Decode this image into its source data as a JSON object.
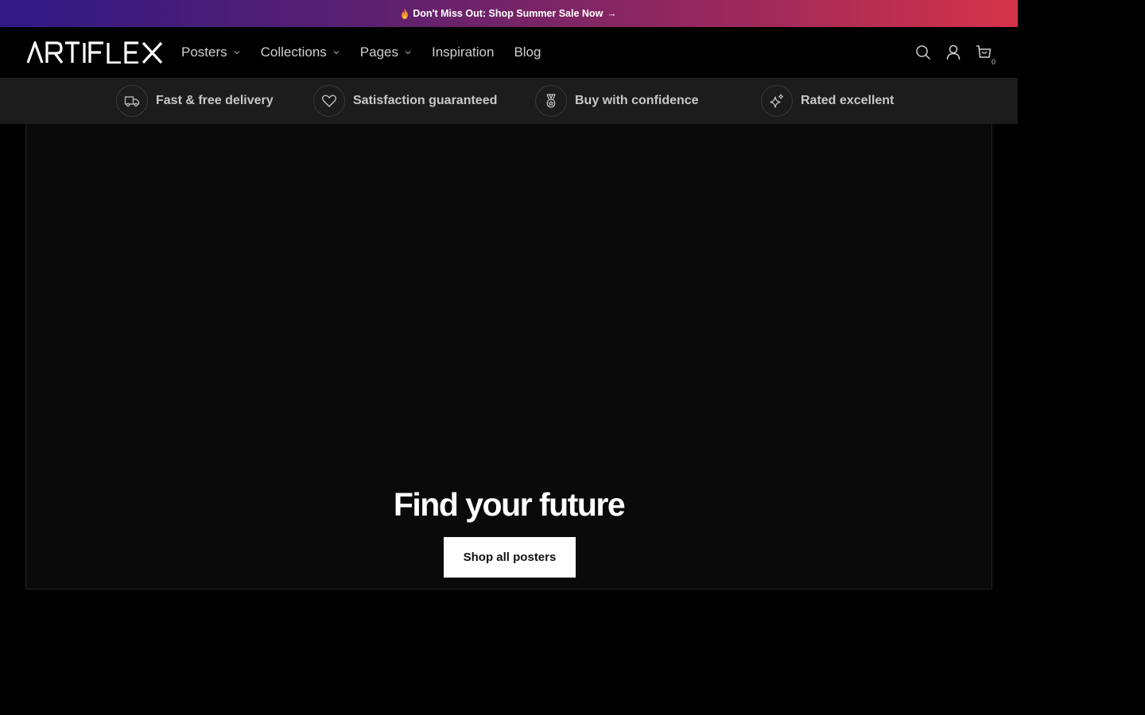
{
  "announcement": {
    "text": "Don't Miss Out: Shop Summer Sale Now",
    "arrow": "→",
    "icon": "flame-icon"
  },
  "header": {
    "logo_text": "ARTIFLEX",
    "nav": [
      {
        "label": "Posters",
        "has_dropdown": true
      },
      {
        "label": "Collections",
        "has_dropdown": true
      },
      {
        "label": "Pages",
        "has_dropdown": true
      },
      {
        "label": "Inspiration",
        "has_dropdown": false
      },
      {
        "label": "Blog",
        "has_dropdown": false
      }
    ],
    "icons": [
      "search-icon",
      "account-icon",
      "cart-icon"
    ],
    "cart_count": "0"
  },
  "benefits": [
    {
      "label": "Fast & free delivery",
      "icon": "truck-icon"
    },
    {
      "label": "Satisfaction guaranteed",
      "icon": "heart-icon"
    },
    {
      "label": "Buy with confidence",
      "icon": "medal-icon"
    },
    {
      "label": "Rated excellent",
      "icon": "sparkle-icon"
    }
  ],
  "hero": {
    "title": "Find your future",
    "button_label": "Shop all posters"
  },
  "colors": {
    "background": "#000000",
    "benefits_bar": "#1c1c1c",
    "hero_background": "#0a0a0a",
    "announcement_gradient_start": "#2f1a86",
    "announcement_gradient_end": "#d6334a",
    "button_background": "#ffffff"
  }
}
